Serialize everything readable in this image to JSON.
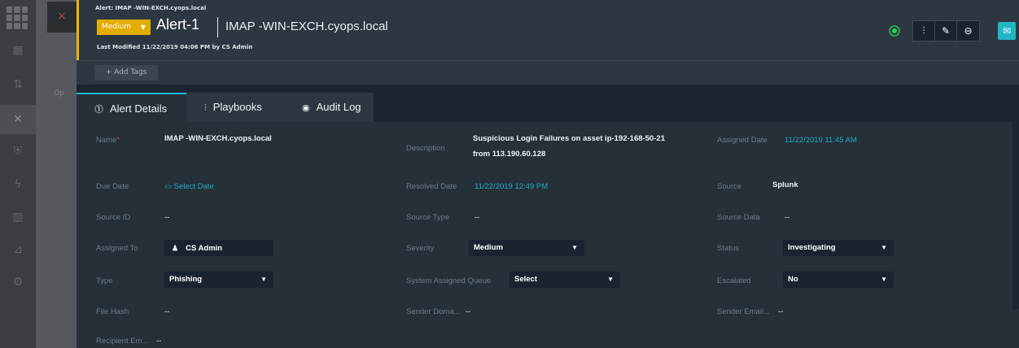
{
  "background": {
    "close_glyph": "×",
    "partial_text": "Op"
  },
  "header": {
    "breadcrumb": "Alert: IMAP -WIN-EXCH.cyops.local",
    "severity": "Medium",
    "title": "Alert-1",
    "subtitle": "IMAP -WIN-EXCH.cyops.local",
    "last_modified": "Last Modified 11/22/2019 04:06 PM by CS Admin",
    "accent_color": "#e2ad00",
    "toolbar_icons": [
      "playbook-icon",
      "edit-pencil-icon",
      "link-icon"
    ],
    "chat_icon": "chat-icon"
  },
  "tags": {
    "add_label": "+ Add Tags"
  },
  "tabs": [
    {
      "label": "Alert Details",
      "icon": "info-icon"
    },
    {
      "label": "Playbooks",
      "icon": "playbook-icon"
    },
    {
      "label": "Audit Log",
      "icon": "eye-icon"
    }
  ],
  "fields": {
    "name": {
      "label": "Name",
      "required_mark": "*",
      "value": "IMAP -WIN-EXCH.cyops.local"
    },
    "description": {
      "label": "Description",
      "value_line1": "Suspicious Login Failures on asset ip-192-168-50-21",
      "value_line2": "from 113.190.60.128"
    },
    "assigned_date": {
      "label": "Assigned Date",
      "value": "11/22/2019 11:45 AM"
    },
    "due_date": {
      "label": "Due Date",
      "value": "Select Date"
    },
    "resolved_date": {
      "label": "Resolved Date",
      "value": "11/22/2019 12:49 PM"
    },
    "source": {
      "label": "Source",
      "value": "Splunk"
    },
    "source_id": {
      "label": "Source ID",
      "value": "--"
    },
    "source_type": {
      "label": "Source Type",
      "value": "--"
    },
    "source_data": {
      "label": "Source Data",
      "value": "--"
    },
    "assigned_to": {
      "label": "Assigned To",
      "value": "CS Admin"
    },
    "severity": {
      "label": "Severity",
      "value": "Medium"
    },
    "status": {
      "label": "Status",
      "value": "Investigating"
    },
    "type": {
      "label": "Type",
      "value": "Phishing"
    },
    "queue": {
      "label": "System Assigned Queue",
      "value": "Select"
    },
    "escalated": {
      "label": "Escalated",
      "value": "No"
    },
    "file_hash": {
      "label": "File Hash",
      "value": "--"
    },
    "sender_domain": {
      "label": "Sender Doma...",
      "value": "--"
    },
    "sender_email": {
      "label": "Sender Email...",
      "value": "--"
    },
    "recipient_email": {
      "label": "Recipient Em...",
      "value": "--"
    }
  }
}
